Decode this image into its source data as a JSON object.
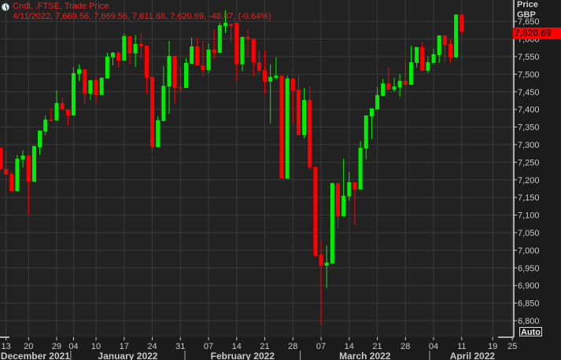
{
  "header": {
    "title": "Cndl, .FTSE, Trade Price",
    "readout": "4/11/2022, 7,669.56, 7,669.56, 7,611.68, 7,620.69, -48.87, (-0.64%)"
  },
  "axis": {
    "price_label": "Price",
    "currency_label": "GBP",
    "last_price": "7,620.69",
    "auto_label": "Auto"
  },
  "colors": {
    "up": "#00ee00",
    "down": "#ff0000",
    "background": "#222222",
    "grid": "#3a3a3a",
    "text": "#c8c8c8"
  },
  "chart_data": {
    "type": "candlestick",
    "title": "Cndl, .FTSE, Trade Price",
    "ylabel": "Price GBP",
    "ylim": [
      6770,
      7700
    ],
    "grid": true,
    "y_ticks": [
      7650,
      7600,
      7550,
      7500,
      7450,
      7400,
      7350,
      7300,
      7250,
      7200,
      7150,
      7100,
      7050,
      7000,
      6950,
      6900,
      6850,
      6800
    ],
    "y_tick_labels": [
      "7,650",
      "7,600",
      "7,550",
      "7,500",
      "7,450",
      "7,400",
      "7,350",
      "7,300",
      "7,250",
      "7,200",
      "7,150",
      "7,100",
      "7,050",
      "7,000",
      "6,950",
      "6,900",
      "6,850",
      "6,800"
    ],
    "x_ticks": [
      {
        "label": "13",
        "index": 1
      },
      {
        "label": "20",
        "index": 5
      },
      {
        "label": "29",
        "index": 10
      },
      {
        "label": "04",
        "index": 13
      },
      {
        "label": "10",
        "index": 17
      },
      {
        "label": "17",
        "index": 22
      },
      {
        "label": "24",
        "index": 27
      },
      {
        "label": "31",
        "index": 32
      },
      {
        "label": "07",
        "index": 37
      },
      {
        "label": "14",
        "index": 42
      },
      {
        "label": "21",
        "index": 47
      },
      {
        "label": "28",
        "index": 52
      },
      {
        "label": "07",
        "index": 57
      },
      {
        "label": "14",
        "index": 62
      },
      {
        "label": "21",
        "index": 67
      },
      {
        "label": "28",
        "index": 72
      },
      {
        "label": "04",
        "index": 77
      },
      {
        "label": "11",
        "index": 82
      },
      {
        "label": "19",
        "index": 87.5
      },
      {
        "label": "25",
        "index": 91
      }
    ],
    "months": [
      {
        "label": "December 2021",
        "start": -1,
        "end": 12.5
      },
      {
        "label": "January 2022",
        "start": 12.5,
        "end": 32.8
      },
      {
        "label": "February 2022",
        "start": 32.8,
        "end": 53.3
      },
      {
        "label": "March 2022",
        "start": 53.3,
        "end": 76.3
      },
      {
        "label": "April 2022",
        "start": 76.3,
        "end": 91.5
      }
    ],
    "ohlc": [
      [
        7291,
        7291,
        7231,
        7231
      ],
      [
        7231,
        7282,
        7215,
        7215
      ],
      [
        7217,
        7224,
        7166,
        7168
      ],
      [
        7168,
        7271,
        7168,
        7260
      ],
      [
        7258,
        7284,
        7235,
        7269
      ],
      [
        7269,
        7269,
        7101,
        7195
      ],
      [
        7195,
        7296,
        7195,
        7296
      ],
      [
        7293,
        7340,
        7271,
        7340
      ],
      [
        7338,
        7383,
        7327,
        7371
      ],
      [
        7371,
        7403,
        7367,
        7367
      ],
      [
        7369,
        7454,
        7369,
        7418
      ],
      [
        7418,
        7432,
        7400,
        7400
      ],
      [
        7400,
        7400,
        7356,
        7383
      ],
      [
        7383,
        7519,
        7383,
        7503
      ],
      [
        7501,
        7528,
        7481,
        7514
      ],
      [
        7514,
        7514,
        7416,
        7445
      ],
      [
        7445,
        7483,
        7427,
        7483
      ],
      [
        7483,
        7494,
        7416,
        7441
      ],
      [
        7441,
        7490,
        7441,
        7490
      ],
      [
        7488,
        7561,
        7488,
        7550
      ],
      [
        7548,
        7563,
        7525,
        7561
      ],
      [
        7561,
        7566,
        7519,
        7539
      ],
      [
        7539,
        7615,
        7539,
        7608
      ],
      [
        7608,
        7608,
        7528,
        7559
      ],
      [
        7559,
        7612,
        7521,
        7586
      ],
      [
        7586,
        7617,
        7546,
        7579
      ],
      [
        7581,
        7581,
        7445,
        7490
      ],
      [
        7492,
        7492,
        7280,
        7293
      ],
      [
        7293,
        7380,
        7293,
        7369
      ],
      [
        7367,
        7523,
        7367,
        7467
      ],
      [
        7465,
        7595,
        7387,
        7552
      ],
      [
        7552,
        7552,
        7416,
        7461
      ],
      [
        7463,
        7521,
        7447,
        7461
      ],
      [
        7461,
        7546,
        7461,
        7532
      ],
      [
        7530,
        7604,
        7530,
        7579
      ],
      [
        7579,
        7604,
        7525,
        7525
      ],
      [
        7525,
        7595,
        7494,
        7512
      ],
      [
        7512,
        7588,
        7503,
        7570
      ],
      [
        7570,
        7628,
        7543,
        7561
      ],
      [
        7561,
        7646,
        7561,
        7639
      ],
      [
        7637,
        7682,
        7617,
        7646
      ],
      [
        7642,
        7644,
        7592,
        7637
      ],
      [
        7646,
        7646,
        7481,
        7528
      ],
      [
        7528,
        7606,
        7508,
        7606
      ],
      [
        7606,
        7628,
        7548,
        7599
      ],
      [
        7601,
        7601,
        7494,
        7534
      ],
      [
        7534,
        7568,
        7503,
        7510
      ],
      [
        7512,
        7568,
        7445,
        7479
      ],
      [
        7479,
        7528,
        7360,
        7492
      ],
      [
        7490,
        7548,
        7485,
        7496
      ],
      [
        7496,
        7496,
        7204,
        7204
      ],
      [
        7204,
        7496,
        7204,
        7488
      ],
      [
        7488,
        7488,
        7358,
        7454
      ],
      [
        7456,
        7496,
        7327,
        7327
      ],
      [
        7327,
        7461,
        7318,
        7427
      ],
      [
        7427,
        7467,
        7229,
        7235
      ],
      [
        7237,
        7237,
        6981,
        6985
      ],
      [
        6988,
        7030,
        6789,
        6956
      ],
      [
        6956,
        7014,
        6892,
        6965
      ],
      [
        6963,
        7191,
        6963,
        7191
      ],
      [
        7191,
        7191,
        7063,
        7097
      ],
      [
        7097,
        7260,
        7097,
        7155
      ],
      [
        7153,
        7222,
        7141,
        7193
      ],
      [
        7193,
        7193,
        7072,
        7173
      ],
      [
        7173,
        7311,
        7173,
        7291
      ],
      [
        7289,
        7383,
        7258,
        7383
      ],
      [
        7380,
        7403,
        7316,
        7403
      ],
      [
        7400,
        7463,
        7400,
        7441
      ],
      [
        7438,
        7487,
        7438,
        7474
      ],
      [
        7474,
        7519,
        7456,
        7456
      ],
      [
        7456,
        7490,
        7450,
        7465
      ],
      [
        7463,
        7501,
        7436,
        7481
      ],
      [
        7481,
        7537,
        7467,
        7470
      ],
      [
        7470,
        7581,
        7470,
        7534
      ],
      [
        7532,
        7577,
        7519,
        7577
      ],
      [
        7577,
        7592,
        7510,
        7510
      ],
      [
        7510,
        7550,
        7503,
        7534
      ],
      [
        7532,
        7572,
        7528,
        7557
      ],
      [
        7554,
        7610,
        7532,
        7610
      ],
      [
        7610,
        7610,
        7532,
        7583
      ],
      [
        7586,
        7599,
        7532,
        7548
      ],
      [
        7548,
        7669.56,
        7548,
        7669.56
      ],
      [
        7669.56,
        7669.56,
        7611.68,
        7620.69
      ]
    ]
  }
}
